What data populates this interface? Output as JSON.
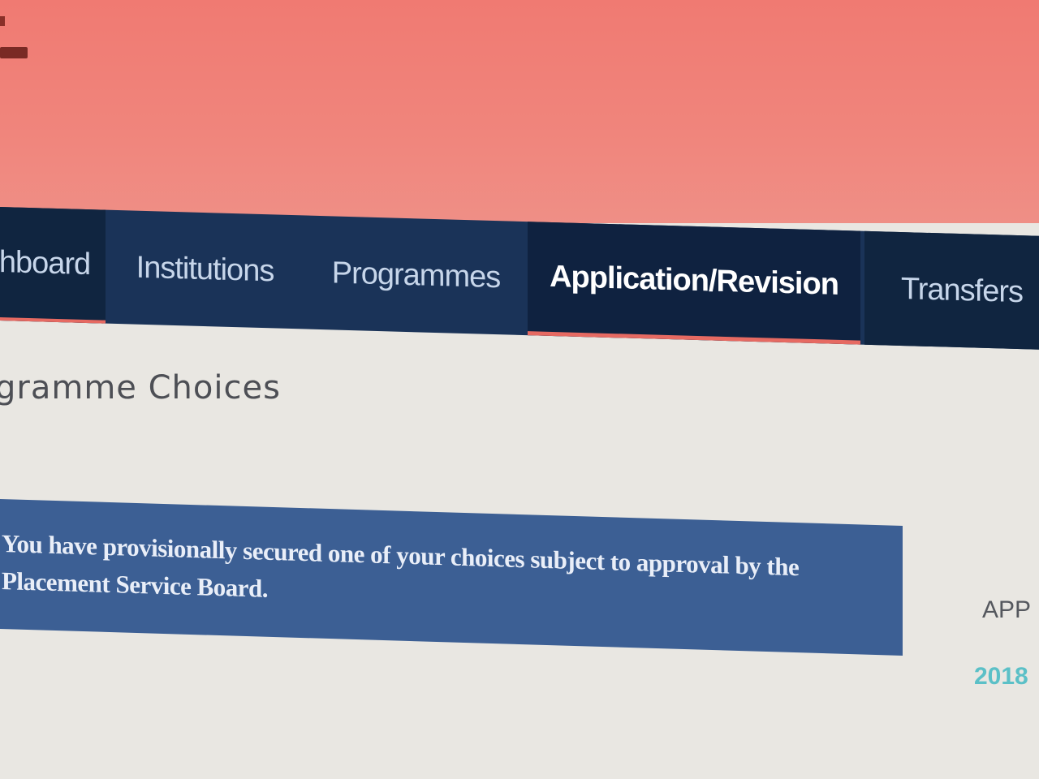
{
  "nav": {
    "items": [
      {
        "label": "hboard"
      },
      {
        "label": "Institutions"
      },
      {
        "label": "Programmes"
      },
      {
        "label": "Application/Revision"
      },
      {
        "label": "Transfers"
      }
    ],
    "active_index": 3
  },
  "main": {
    "title": "gramme Choices",
    "alert": {
      "text": "You have provisionally secured one of your choices subject to approval by the Placement Service Board."
    },
    "side_label": "APP",
    "side_year": "2018"
  },
  "colors": {
    "header_bg": "#f07a72",
    "nav_bg": "#1a3358",
    "nav_active_bg": "#0f2240",
    "accent_red": "#e66a62",
    "alert_bg": "#3c5f94",
    "year_color": "#5bc0c7"
  }
}
